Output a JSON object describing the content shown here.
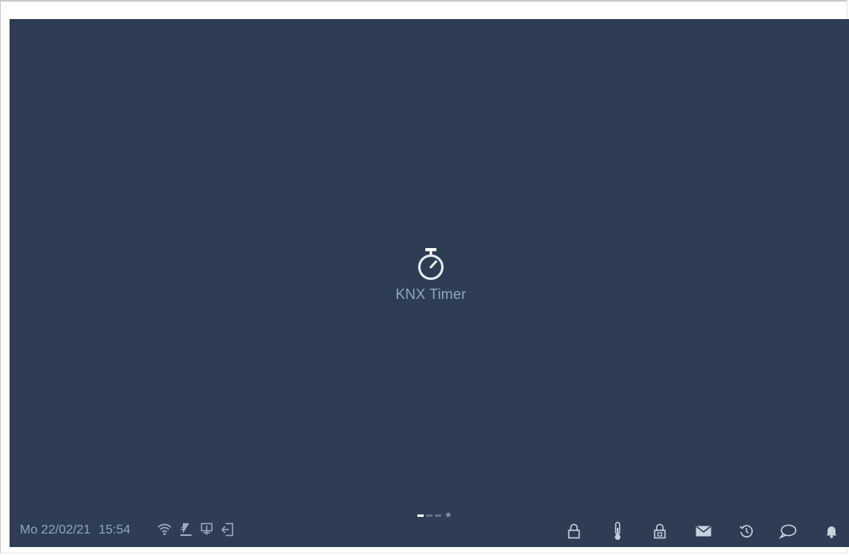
{
  "app": {
    "label": "KNX Timer",
    "icon": "stopwatch-icon"
  },
  "page_indicator": {
    "pages": 3,
    "active_page": 1,
    "favorites_icon": "star-icon"
  },
  "status_bar": {
    "date": "Mo 22/02/21",
    "time": "15:54",
    "left_icons": [
      "wifi-icon",
      "card-reader-icon",
      "presentation-icon",
      "exit-door-icon"
    ],
    "right_icons": [
      "lock-icon",
      "thermometer-icon",
      "door-unlock-icon",
      "mail-icon",
      "history-icon",
      "chat-icon",
      "bell-icon"
    ]
  },
  "colors": {
    "background": "#2e3d54",
    "text": "#8fa5bf",
    "icon": "#c8d2de"
  }
}
